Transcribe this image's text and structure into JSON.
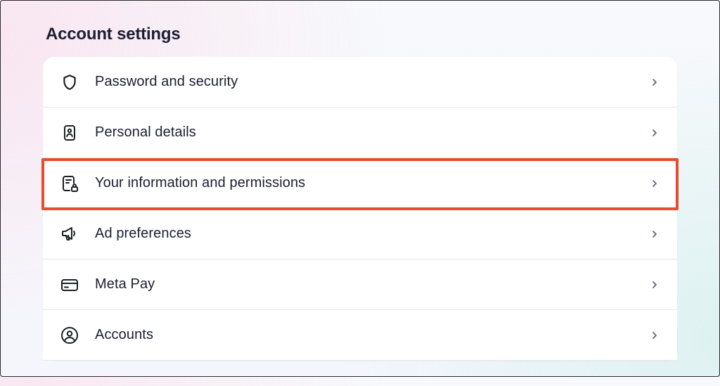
{
  "page_title": "Account settings",
  "items": [
    {
      "icon": "shield-icon",
      "label": "Password and security"
    },
    {
      "icon": "id-card-icon",
      "label": "Personal details"
    },
    {
      "icon": "doc-lock-icon",
      "label": "Your information and permissions",
      "highlighted": true
    },
    {
      "icon": "megaphone-icon",
      "label": "Ad preferences"
    },
    {
      "icon": "card-icon",
      "label": "Meta Pay"
    },
    {
      "icon": "user-circle-icon",
      "label": "Accounts"
    }
  ]
}
